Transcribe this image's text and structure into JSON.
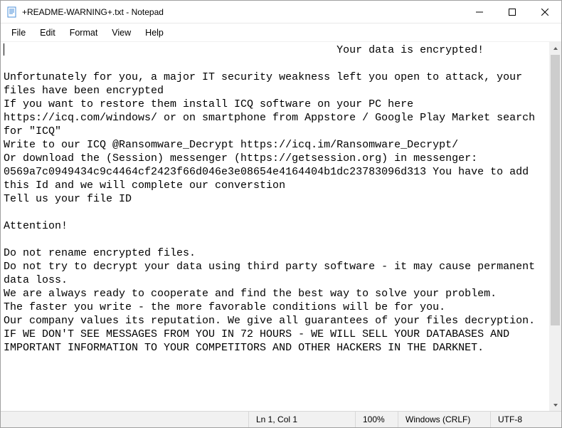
{
  "titlebar": {
    "title": "+README-WARNING+.txt - Notepad"
  },
  "menubar": {
    "file": "File",
    "edit": "Edit",
    "format": "Format",
    "view": "View",
    "help": "Help"
  },
  "document": {
    "text": "                                                    Your data is encrypted!\n\nUnfortunately for you, a major IT security weakness left you open to attack, your files have been encrypted\nIf you want to restore them install ICQ software on your PC here https://icq.com/windows/ or on smartphone from Appstore / Google Play Market search for \"ICQ\"\nWrite to our ICQ @Ransomware_Decrypt https://icq.im/Ransomware_Decrypt/\nOr download the (Session) messenger (https://getsession.org) in messenger: 0569a7c0949434c9c4464cf2423f66d046e3e08654e4164404b1dc23783096d313 You have to add this Id and we will complete our converstion\nTell us your file ID\n\nAttention!\n\nDo not rename encrypted files.\nDo not try to decrypt your data using third party software - it may cause permanent data loss.\nWe are always ready to cooperate and find the best way to solve your problem.\nThe faster you write - the more favorable conditions will be for you.\nOur company values its reputation. We give all guarantees of your files decryption.\nIF WE DON'T SEE MESSAGES FROM YOU IN 72 HOURS - WE WILL SELL YOUR DATABASES AND IMPORTANT INFORMATION TO YOUR COMPETITORS AND OTHER HACKERS IN THE DARKNET."
  },
  "statusbar": {
    "position": "Ln 1, Col 1",
    "zoom": "100%",
    "line_ending": "Windows (CRLF)",
    "encoding": "UTF-8"
  }
}
